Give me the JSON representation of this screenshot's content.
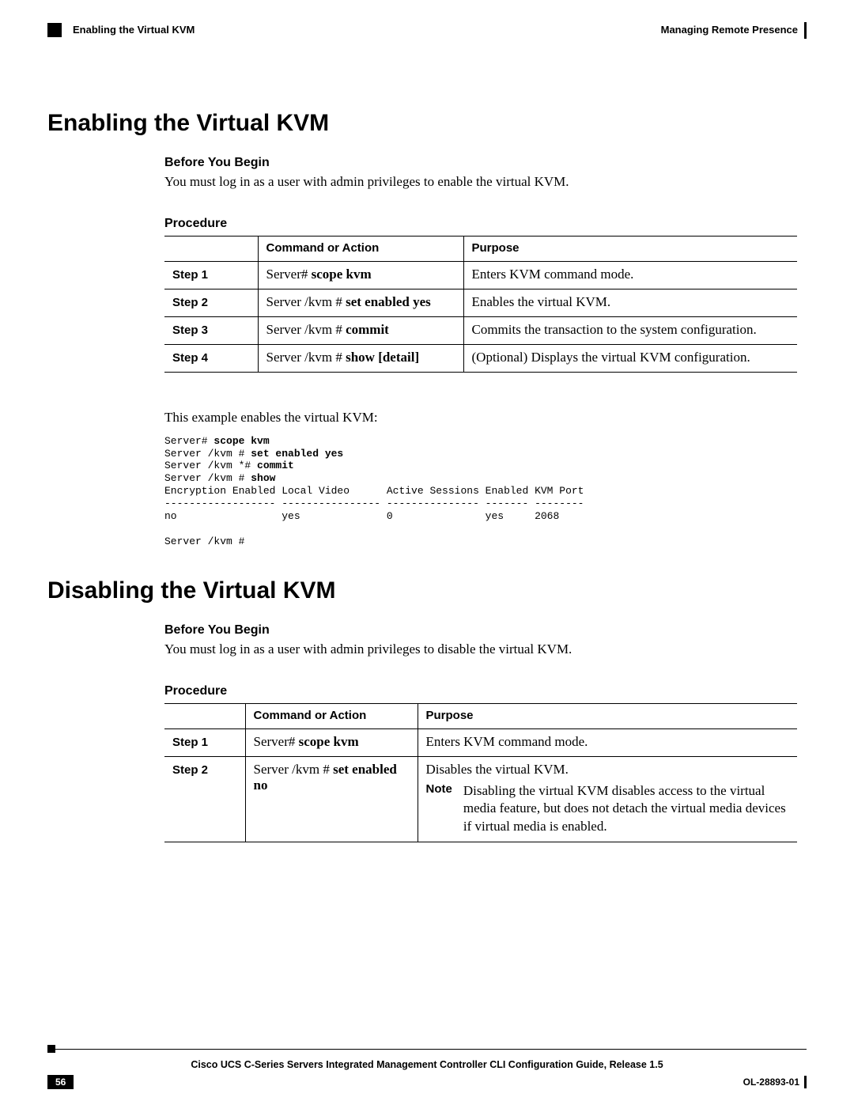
{
  "header": {
    "left": "Enabling the Virtual KVM",
    "right": "Managing Remote Presence"
  },
  "section1": {
    "title": "Enabling the Virtual KVM",
    "before_heading": "Before You Begin",
    "before_text": "You must log in as a user with admin privileges to enable the virtual KVM.",
    "procedure_heading": "Procedure",
    "table": {
      "col_cmd": "Command or Action",
      "col_purpose": "Purpose",
      "rows": [
        {
          "step": "Step 1",
          "prompt": "Server#",
          "cmd": "scope kvm",
          "purpose": "Enters KVM command mode."
        },
        {
          "step": "Step 2",
          "prompt": "Server /kvm #",
          "cmd": "set enabled yes",
          "purpose": "Enables the virtual KVM."
        },
        {
          "step": "Step 3",
          "prompt": "Server /kvm #",
          "cmd": "commit",
          "purpose": "Commits the transaction to the system configuration."
        },
        {
          "step": "Step 4",
          "prompt": "Server /kvm #",
          "cmd": "show",
          "optarg": "[detail]",
          "purpose": "(Optional) Displays the virtual KVM configuration."
        }
      ]
    },
    "example_intro": "This example enables the virtual KVM:",
    "sample": {
      "l1p": "Server# ",
      "l1c": "scope kvm",
      "l2p": "Server /kvm # ",
      "l2c": "set enabled yes",
      "l3p": "Server /kvm *# ",
      "l3c": "commit",
      "l4p": "Server /kvm # ",
      "l4c": "show",
      "hdr": "Encryption Enabled Local Video      Active Sessions Enabled KVM Port",
      "sep": "------------------ ---------------- --------------- ------- --------",
      "row": "no                 yes              0               yes     2068",
      "tail": "Server /kvm #"
    }
  },
  "section2": {
    "title": "Disabling the Virtual KVM",
    "before_heading": "Before You Begin",
    "before_text": "You must log in as a user with admin privileges to disable the virtual KVM.",
    "procedure_heading": "Procedure",
    "table": {
      "col_cmd": "Command or Action",
      "col_purpose": "Purpose",
      "rows": [
        {
          "step": "Step 1",
          "prompt": "Server#",
          "cmd": "scope kvm",
          "purpose": "Enters KVM command mode."
        },
        {
          "step": "Step 2",
          "prompt": "Server /kvm #",
          "cmd": "set enabled no",
          "purpose": "Disables the virtual KVM.",
          "note_label": "Note",
          "note": "Disabling the virtual KVM disables access to the virtual media feature, but does not detach the virtual media devices if virtual media is enabled."
        }
      ]
    }
  },
  "footer": {
    "title": "Cisco UCS C-Series Servers Integrated Management Controller CLI Configuration Guide, Release 1.5",
    "page": "56",
    "docnum": "OL-28893-01"
  }
}
